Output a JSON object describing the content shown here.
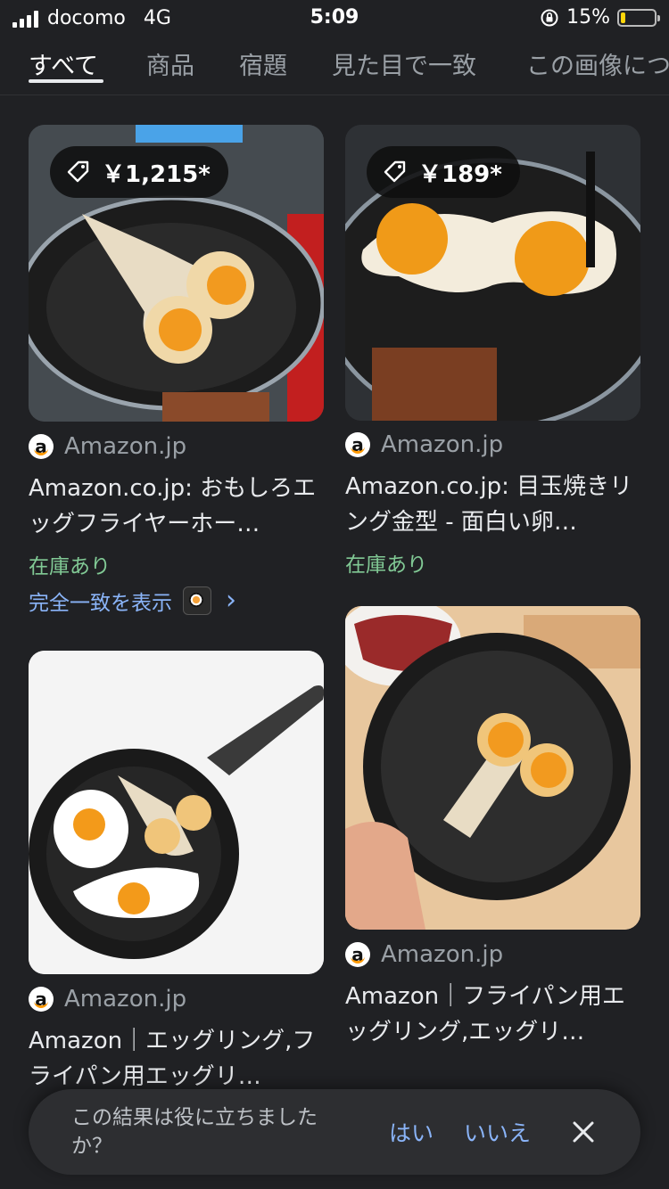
{
  "status_bar": {
    "carrier": "docomo",
    "network": "4G",
    "time": "5:09",
    "battery": "15%",
    "battery_level": 0.15
  },
  "tabs": [
    {
      "label": "すべて",
      "active": true
    },
    {
      "label": "商品"
    },
    {
      "label": "宿題"
    },
    {
      "label": "見た目で一致"
    },
    {
      "label": "この画像につ"
    }
  ],
  "results": [
    {
      "price": "￥1,215*",
      "source": "Amazon.jp",
      "title": "Amazon.co.jp: おもしろエッグフライヤーホー…",
      "stock": "在庫あり"
    },
    {
      "price": "￥189*",
      "source": "Amazon.jp",
      "title": "Amazon.co.jp: 目玉焼きリング金型 - 面白い卵…",
      "stock": "在庫あり"
    },
    {
      "source": "Amazon.jp",
      "title": "Amazon｜エッグリング,フライパン用エッグリ…"
    },
    {
      "source": "Amazon.jp",
      "title": "Amazon｜フライパン用エッグリング,エッグリ…"
    }
  ],
  "exact_match": {
    "label": "完全一致を表示",
    "chevron": "›"
  },
  "feedback": {
    "question": "この結果は役に立ちましたか？",
    "yes": "はい",
    "no": "いいえ"
  },
  "colors": {
    "background": "#202124",
    "link": "#8ab4f8",
    "stock_green": "#81c995",
    "battery": "#ffd60a"
  }
}
